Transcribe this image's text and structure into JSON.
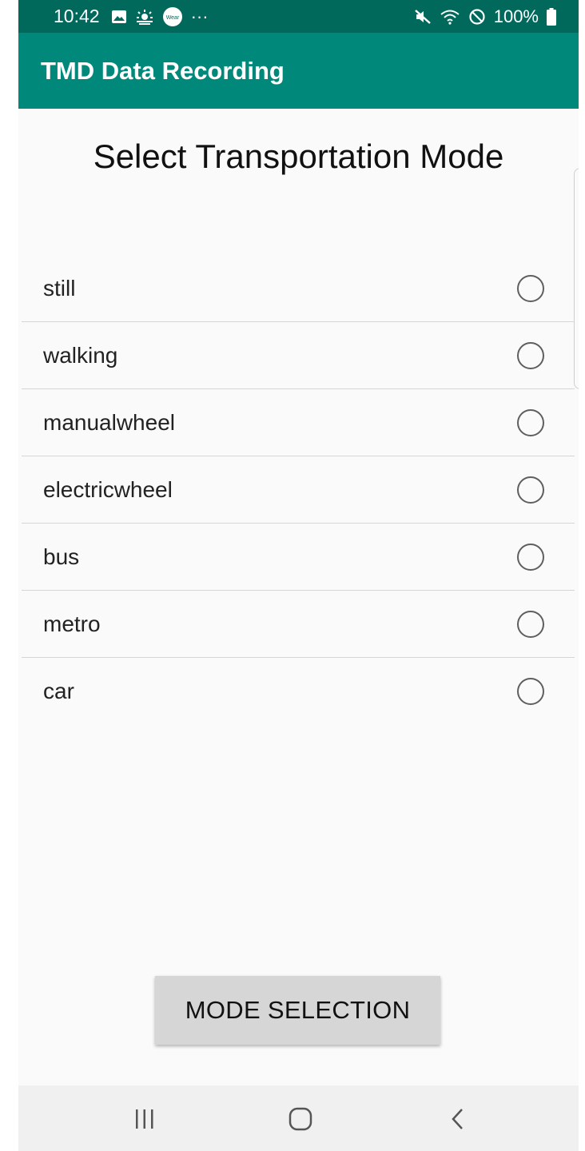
{
  "status_bar": {
    "time": "10:42",
    "left_icons": [
      "gallery-icon",
      "weather-icon",
      "wear-icon",
      "more-icon"
    ],
    "wear_label": "Wear",
    "more_label": "···",
    "right_icons": [
      "mute-icon",
      "wifi-icon",
      "block-icon",
      "battery-icon"
    ],
    "battery": "100%"
  },
  "app_bar": {
    "title": "TMD Data Recording"
  },
  "main": {
    "title": "Select Transportation Mode",
    "modes": [
      {
        "label": "still",
        "selected": false
      },
      {
        "label": "walking",
        "selected": false
      },
      {
        "label": "manualwheel",
        "selected": false
      },
      {
        "label": "electricwheel",
        "selected": false
      },
      {
        "label": "bus",
        "selected": false
      },
      {
        "label": "metro",
        "selected": false
      },
      {
        "label": "car",
        "selected": false
      }
    ],
    "button_label": "MODE SELECTION"
  },
  "nav_bar": {
    "buttons": [
      "recents-icon",
      "home-icon",
      "back-icon"
    ]
  },
  "colors": {
    "status_bar": "#00695c",
    "app_bar": "#00897b",
    "background": "#fafafa",
    "button": "#d6d6d6"
  }
}
